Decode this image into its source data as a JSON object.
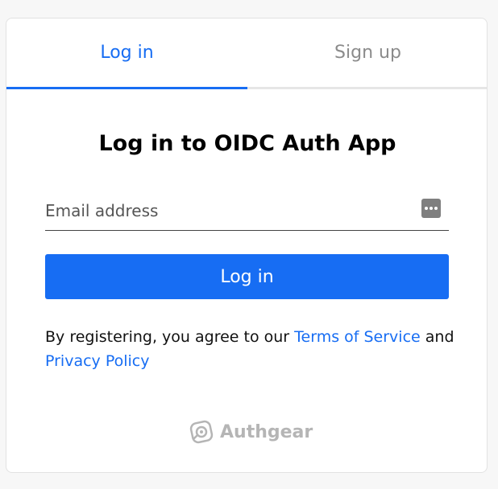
{
  "tabs": [
    {
      "label": "Log in",
      "active": true
    },
    {
      "label": "Sign up",
      "active": false
    }
  ],
  "page_title": "Log in to OIDC Auth App",
  "email_input": {
    "value": "",
    "placeholder": "Email address"
  },
  "icons": {
    "password_manager": "password-manager-icon",
    "brand_logo": "authgear-logo-icon"
  },
  "login_button_label": "Log in",
  "terms": {
    "prefix": "By registering, you agree to our",
    "terms_of_service": "Terms of Service",
    "and": "and",
    "privacy_policy": "Privacy Policy"
  },
  "brand_name": "Authgear",
  "colors": {
    "accent": "#176df3",
    "inactive_tab": "#8b8b8b",
    "brand_gray": "#b5b5b5"
  }
}
